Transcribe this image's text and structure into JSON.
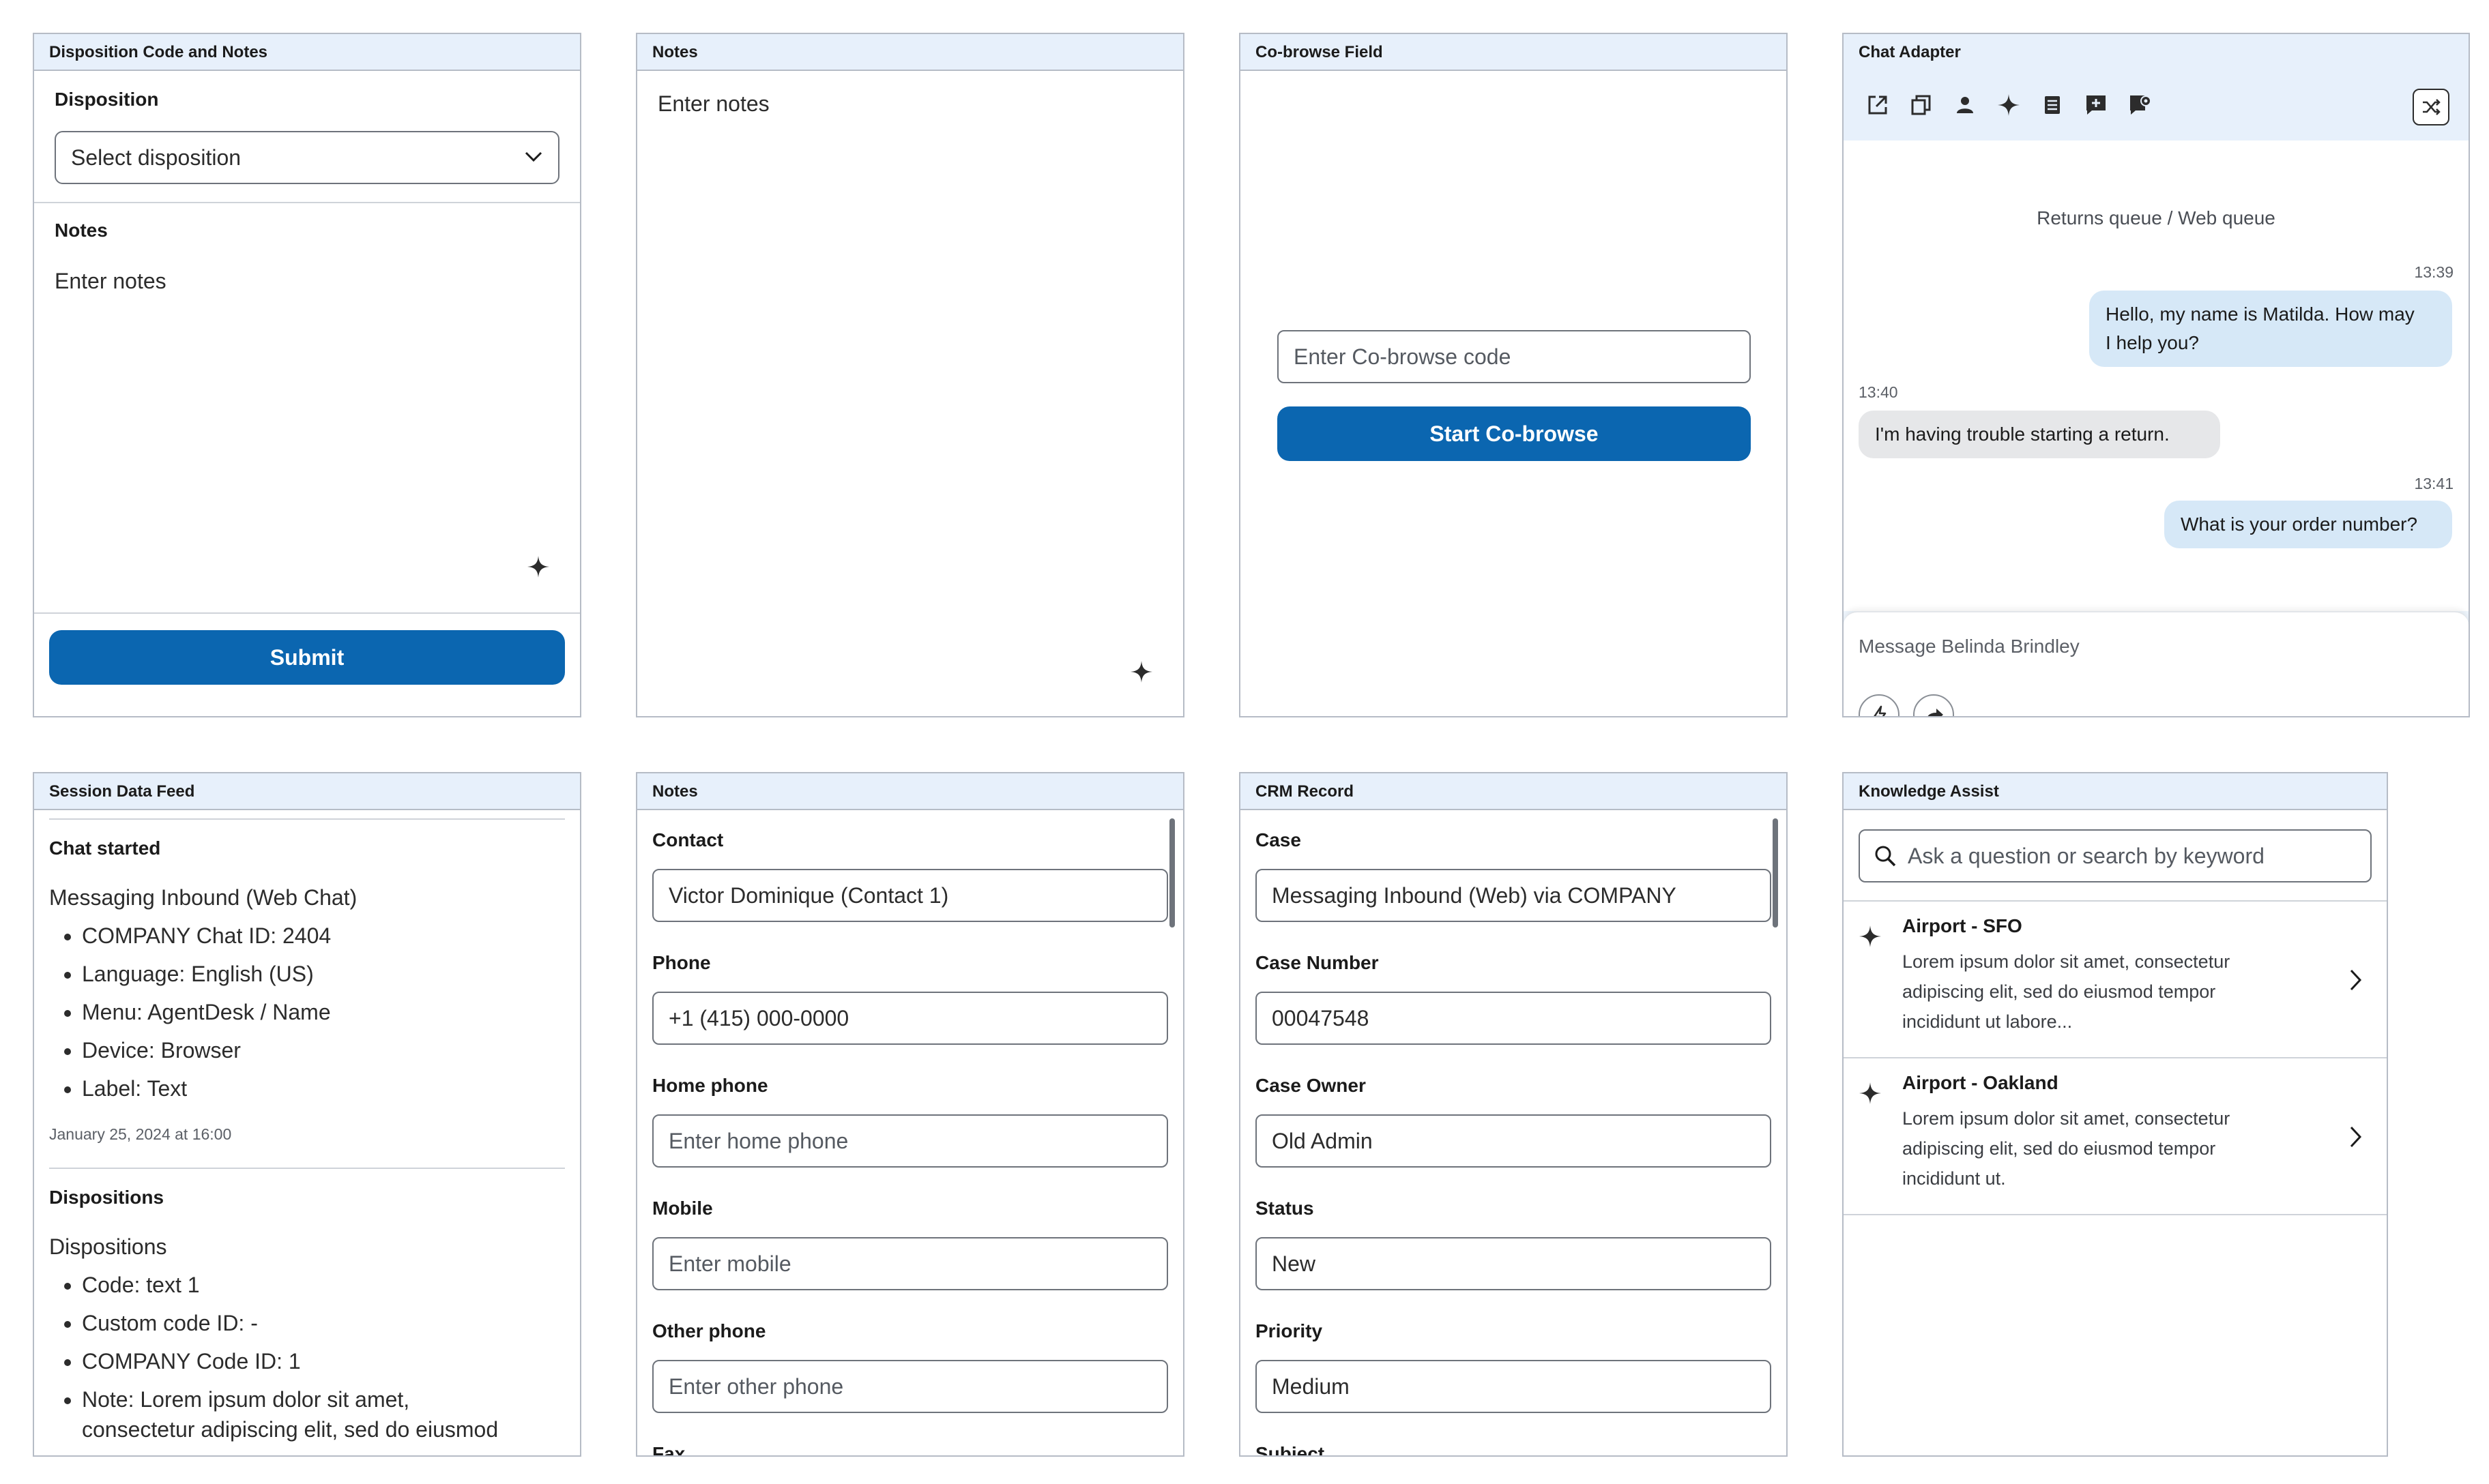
{
  "disposition_panel": {
    "header": "Disposition Code and Notes",
    "disposition_label": "Disposition",
    "disposition_select_placeholder": "Select disposition",
    "notes_label": "Notes",
    "notes_placeholder": "Enter notes",
    "submit_label": "Submit"
  },
  "notes_panel_top": {
    "header": "Notes",
    "notes_placeholder": "Enter notes"
  },
  "cobrowse_panel": {
    "header": "Co-browse Field",
    "code_placeholder": "Enter Co-browse code",
    "start_label": "Start Co-browse"
  },
  "chat_panel": {
    "header": "Chat Adapter",
    "queue": "Returns queue / Web queue",
    "messages": [
      {
        "time": "13:39",
        "text_line1": "Hello, my name is Matilda. How may",
        "text_line2": "I help you?",
        "direction": "out"
      },
      {
        "time": "13:40",
        "text_line1": "I'm having trouble starting a return.",
        "direction": "in"
      },
      {
        "time": "13:41",
        "text_line1": "What is your order number?",
        "direction": "out"
      }
    ],
    "composer_placeholder": "Message Belinda Brindley",
    "toolbar_icons": [
      "popout-icon",
      "copy-icon",
      "person-icon",
      "sparkle-icon",
      "list-icon",
      "chat-add-icon",
      "chat-settings-icon",
      "transfer-icon"
    ],
    "bottom_icons": [
      "lightning-icon",
      "forward-icon"
    ]
  },
  "session_panel": {
    "header": "Session Data Feed",
    "chat_started_title": "Chat started",
    "chat_started_subtitle": "Messaging Inbound (Web Chat)",
    "chat_items": [
      "COMPANY Chat ID: 2404",
      "Language: English (US)",
      "Menu: AgentDesk / Name",
      "Device: Browser",
      "Label: Text"
    ],
    "timestamp": "January 25, 2024 at 16:00",
    "dispositions_title": "Dispositions",
    "dispositions_subtitle": "Dispositions",
    "disposition_items": [
      "Code: text 1",
      "Custom code ID: -",
      "COMPANY Code ID: 1",
      "Note: Lorem ipsum dolor sit amet,"
    ],
    "note_continuation": "consectetur adipiscing elit, sed do eiusmod"
  },
  "contact_panel": {
    "header": "Notes",
    "fields": [
      {
        "label": "Contact",
        "value": "Victor Dominique (Contact 1)",
        "placeholder": ""
      },
      {
        "label": "Phone",
        "value": "+1 (415) 000-0000",
        "placeholder": ""
      },
      {
        "label": "Home phone",
        "value": "",
        "placeholder": "Enter home phone"
      },
      {
        "label": "Mobile",
        "value": "",
        "placeholder": "Enter mobile"
      },
      {
        "label": "Other phone",
        "value": "",
        "placeholder": "Enter other phone"
      }
    ],
    "cut_label": "Fax"
  },
  "crm_panel": {
    "header": "CRM Record",
    "fields": [
      {
        "label": "Case",
        "value": "Messaging Inbound (Web) via COMPANY"
      },
      {
        "label": "Case Number",
        "value": "00047548"
      },
      {
        "label": "Case Owner",
        "value": "Old Admin"
      },
      {
        "label": "Status",
        "value": "New"
      },
      {
        "label": "Priority",
        "value": "Medium"
      }
    ],
    "cut_label": "Subject"
  },
  "knowledge_panel": {
    "header": "Knowledge Assist",
    "search_placeholder": "Ask a question or search by keyword",
    "results": [
      {
        "title": "Airport - SFO",
        "line1": "Lorem ipsum dolor sit amet, consectetur",
        "line2": "adipiscing elit, sed do eiusmod tempor",
        "line3": "incididunt ut labore..."
      },
      {
        "title": "Airport - Oakland",
        "line1": "Lorem ipsum dolor sit amet, consectetur",
        "line2": "adipiscing elit, sed do eiusmod tempor",
        "line3": "incididunt ut."
      }
    ]
  }
}
